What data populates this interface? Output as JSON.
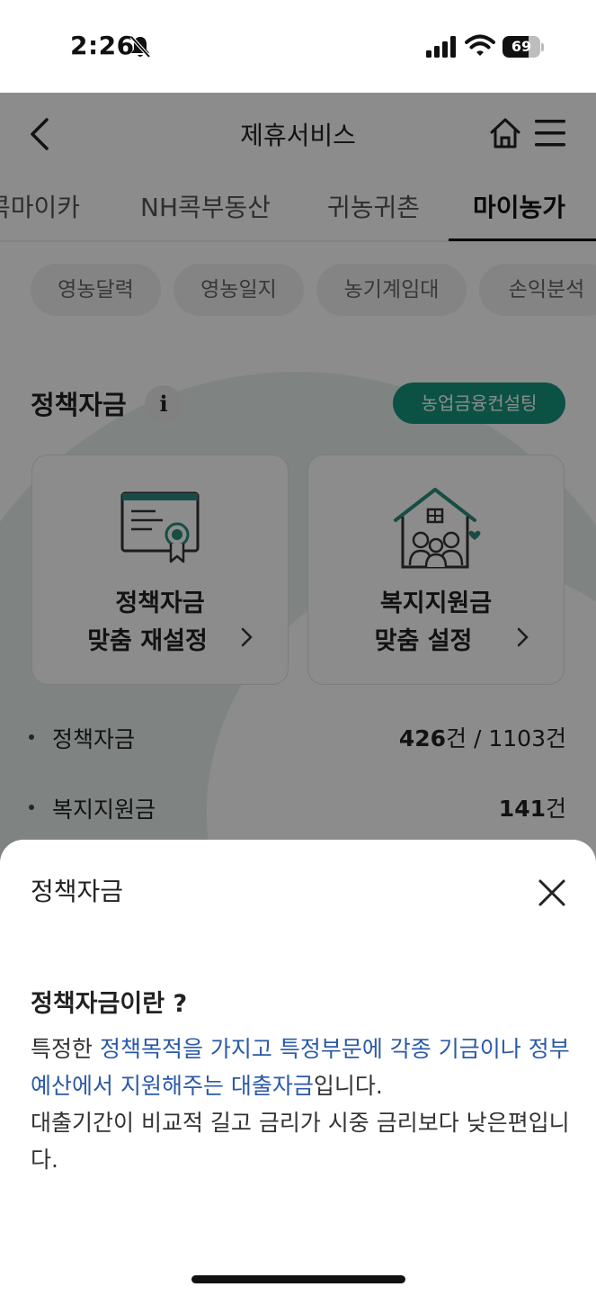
{
  "status_bar": {
    "time": "2:26",
    "battery_level": "69",
    "battery_fraction": 0.69,
    "icons": [
      "bell-slash-icon",
      "cellular-signal-icon",
      "wifi-icon",
      "battery-icon"
    ]
  },
  "header": {
    "title": "제휴서비스",
    "icons": [
      "chevron-left-icon",
      "home-icon",
      "hamburger-menu-icon"
    ]
  },
  "tabs": [
    {
      "label": "콕마이카",
      "active": false
    },
    {
      "label": "NH콕부동산",
      "active": false
    },
    {
      "label": "귀농귀촌",
      "active": false
    },
    {
      "label": "마이농가",
      "active": true
    }
  ],
  "chips": [
    "영농달력",
    "영농일지",
    "농기계임대",
    "손익분석"
  ],
  "section": {
    "title": "정책자금",
    "info_label": "i",
    "consult_button": "농업금융컨설팅"
  },
  "cards": [
    {
      "line1": "정책자금",
      "line2": "맞춤 재설정",
      "icon": "certificate-icon"
    },
    {
      "line1": "복지지원금",
      "line2": "맞춤 설정",
      "icon": "family-house-icon"
    }
  ],
  "stats": [
    {
      "label": "정책자금",
      "value_bold": "426",
      "value_rest": "건 / 1103건"
    },
    {
      "label": "복지지원금",
      "value_bold": "141",
      "value_rest": "건"
    }
  ],
  "sheet": {
    "title": "정책자금",
    "heading": "정책자금이란 ?",
    "body": {
      "part1": "특정한 ",
      "highlight": "정책목적을 가지고 특정부문에 각종 기금이나 정부 예산에서 지원해주는 대출자금",
      "part2": "입니다.",
      "part3": "대출기간이 비교적 길고 금리가 시중 금리보다 낮은편입니다."
    },
    "highlight_color": "#2b5aa8"
  },
  "colors": {
    "accent": "#14967f",
    "overlay": "rgba(0,0,0,0.45)"
  }
}
